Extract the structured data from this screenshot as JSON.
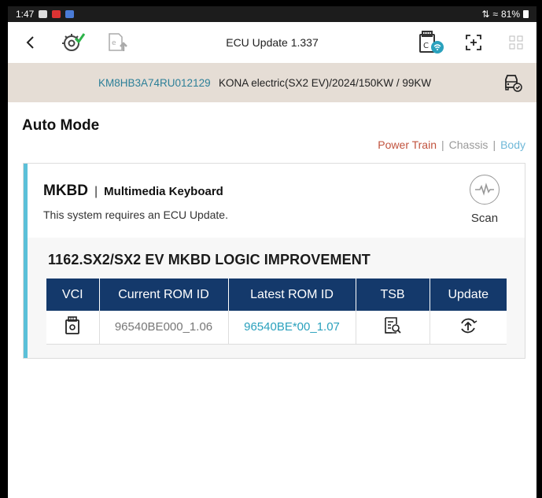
{
  "status_bar": {
    "time": "1:47",
    "battery": "81%"
  },
  "toolbar": {
    "title": "ECU Update 1.337"
  },
  "vehicle": {
    "vin": "KM8HB3A74RU012129",
    "model": "KONA electric(SX2 EV)/2024/150KW / 99KW"
  },
  "page": {
    "title": "Auto Mode",
    "categories": [
      "Power Train",
      "Chassis",
      "Body"
    ],
    "category_separator": "|"
  },
  "system": {
    "code": "MKBD",
    "separator": "|",
    "name": "Multimedia Keyboard",
    "message": "This system requires an ECU Update.",
    "scan_label": "Scan"
  },
  "update": {
    "title": "1162.SX2/SX2 EV MKBD LOGIC IMPROVEMENT",
    "columns": [
      "VCI",
      "Current ROM ID",
      "Latest ROM ID",
      "TSB",
      "Update"
    ],
    "row": {
      "current_rom": "96540BE000_1.06",
      "latest_rom": "96540BE*00_1.07"
    }
  },
  "colors": {
    "accent_teal": "#2aa1bd",
    "header_navy": "#14396b",
    "power_train": "#c1533e",
    "body": "#6fb8d8",
    "vin_bar": "#e5ddd5"
  },
  "icons": {
    "back": "chevron-left-icon",
    "diag": "gear-check-icon",
    "ecu_upload": "ecu-upload-icon",
    "vci_wifi": "vci-wifi-icon",
    "fullscreen": "expand-icon",
    "grid": "grid-icon",
    "car_settings": "car-settings-icon",
    "scan": "pulse-icon",
    "vci": "vci-icon",
    "tsb": "document-search-icon",
    "update": "upload-circle-icon"
  }
}
